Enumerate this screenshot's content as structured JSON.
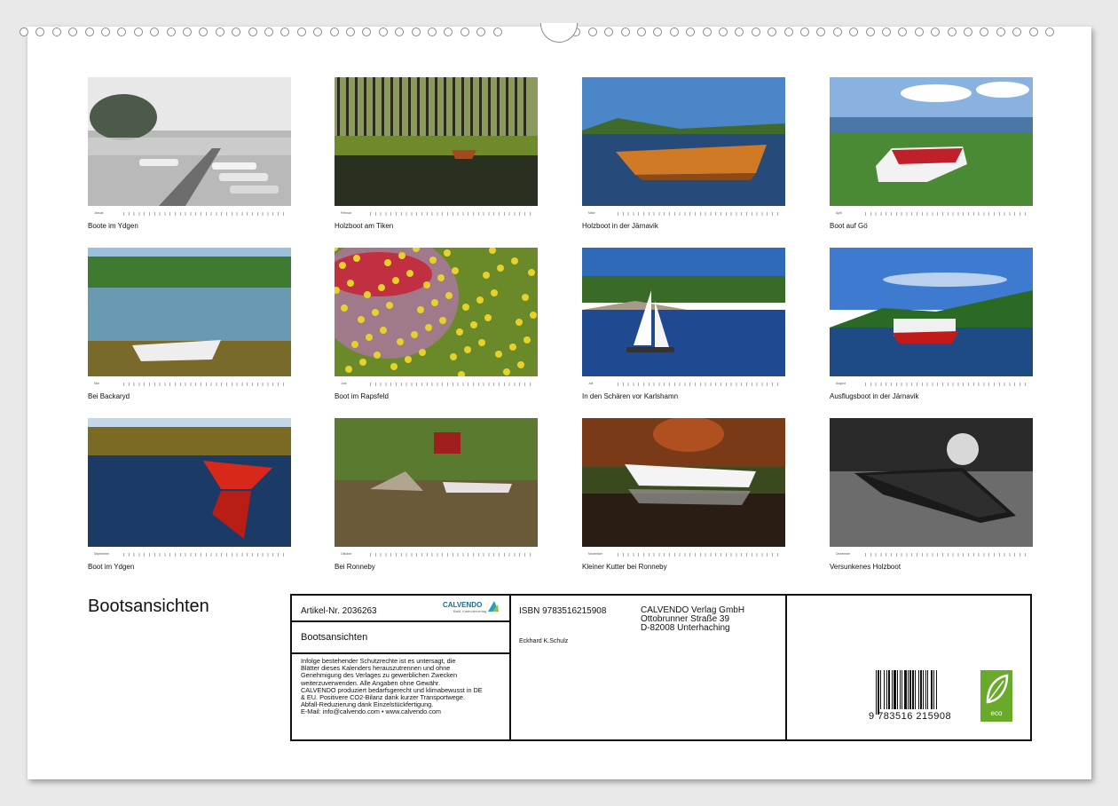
{
  "calendar": {
    "title": "Bootsansichten",
    "months": [
      {
        "month": "Januar",
        "caption": "Boote im Ydgen",
        "scene": "fog"
      },
      {
        "month": "Februar",
        "caption": "Holzboot am Tiken",
        "scene": "forest-pond"
      },
      {
        "month": "März",
        "caption": "Holzboot in der Järnavik",
        "scene": "orange-boat"
      },
      {
        "month": "April",
        "caption": "Boot auf Gö",
        "scene": "grass-boat"
      },
      {
        "month": "Mai",
        "caption": "Bei Backaryd",
        "scene": "lake-boat"
      },
      {
        "month": "Juni",
        "caption": "Boot im Rapsfeld",
        "scene": "rapeseed"
      },
      {
        "month": "Juli",
        "caption": "In den Schären vor Karlshamn",
        "scene": "sailboat"
      },
      {
        "month": "August",
        "caption": "Ausflugsboot in der Järnavik",
        "scene": "ferry"
      },
      {
        "month": "September",
        "caption": "Boot im Ydgen",
        "scene": "red-boat"
      },
      {
        "month": "Oktober",
        "caption": "Bei Ronneby",
        "scene": "river-house"
      },
      {
        "month": "November",
        "caption": "Kleiner Kutter bei Ronneby",
        "scene": "white-boat"
      },
      {
        "month": "Dezember",
        "caption": "Versunkenes Holzboot",
        "scene": "sunken"
      }
    ]
  },
  "info": {
    "article": "Artikel-Nr. 2036263",
    "brand": "CALVENDO",
    "brand_sub": "Bald. Kalenderverlag",
    "product_title": "Bootsansichten",
    "isbn": "ISBN 9783516215908",
    "author": "Eckhard K.Schulz",
    "publisher": [
      "CALVENDO Verlag GmbH",
      "Ottobrunner Straße 39",
      "D-82008 Unterhaching"
    ],
    "legal": "Infolge bestehender Schutzrechte ist es untersagt, die\nBlätter dieses Kalenders herauszutrennen und ohne\nGenehmigung des Verlages zu gewerblichen Zwecken\nweiterzuverwenden. Alle Angaben ohne Gewähr.\nCALVENDO produziert bedarfsgerecht und klimabewusst in DE\n& EU. Positivere CO2-Bilanz dank kurzer Transportwege.\nAbfall-Reduzierung dank Einzelstückfertigung.\nE-Mail: info@calvendo.com • www.calvendo.com",
    "barcode_number": "9 783516 215908",
    "eco_label": "eco"
  }
}
